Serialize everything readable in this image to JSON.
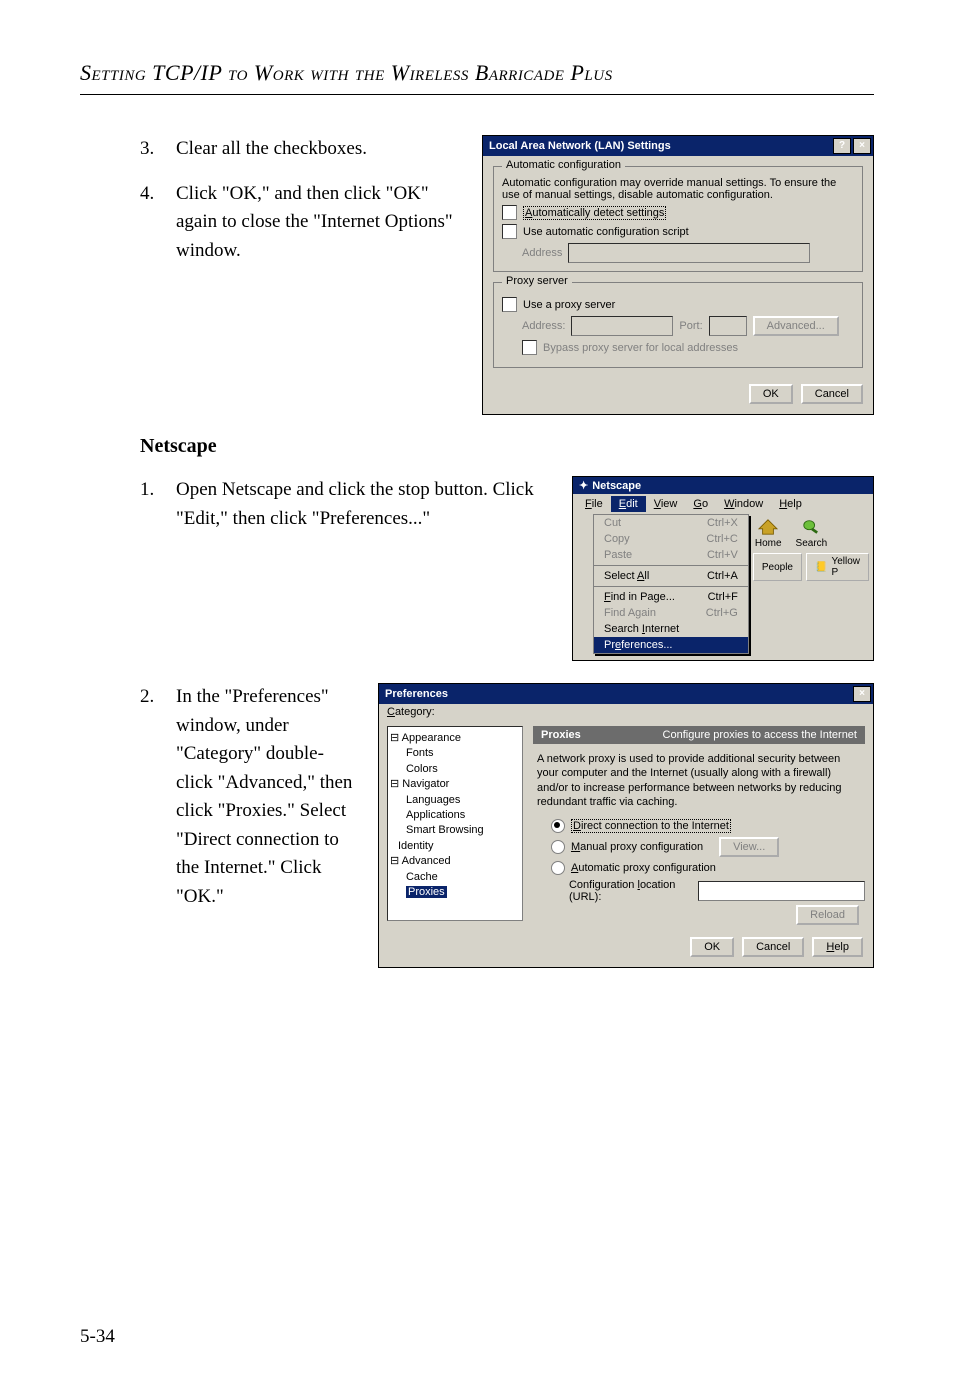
{
  "page": {
    "title": "Setting TCP/IP to Work with the Wireless Barricade Plus",
    "number": "5-34"
  },
  "sections": {
    "netscape_heading": "Netscape"
  },
  "steps_top": [
    {
      "num": "3.",
      "text": "Clear all the checkboxes."
    },
    {
      "num": "4.",
      "text": "Click \"OK,\" and then click \"OK\" again to close the \"Internet Options\" window."
    }
  ],
  "steps_netscape": [
    {
      "num": "1.",
      "text": "Open Netscape and click the stop button. Click \"Edit,\" then click \"Preferences...\""
    },
    {
      "num": "2.",
      "text": "In the \"Preferences\" window, under \"Category\" double-click \"Advanced,\" then click \"Proxies.\" Select \"Direct connection to the Internet.\" Click \"OK.\""
    }
  ],
  "lan": {
    "title": "Local Area Network (LAN) Settings",
    "group1": {
      "legend": "Automatic configuration",
      "desc": "Automatic configuration may override manual settings.  To ensure the use of manual settings, disable automatic configuration.",
      "chk_auto_detect": "Automatically detect settings",
      "chk_use_script": "Use automatic configuration script",
      "addr_label": "Address"
    },
    "group2": {
      "legend": "Proxy server",
      "chk_use_proxy": "Use a proxy server",
      "addr_label": "Address:",
      "port_label": "Port:",
      "advanced": "Advanced...",
      "chk_bypass": "Bypass proxy server for local addresses"
    },
    "ok": "OK",
    "cancel": "Cancel"
  },
  "ns": {
    "title": "Netscape",
    "menu": [
      "File",
      "Edit",
      "View",
      "Go",
      "Window",
      "Help"
    ],
    "dropdown": [
      {
        "label": "Cut",
        "accel": "Ctrl+X",
        "disabled": true
      },
      {
        "label": "Copy",
        "accel": "Ctrl+C",
        "disabled": true
      },
      {
        "label": "Paste",
        "accel": "Ctrl+V",
        "disabled": true
      },
      {
        "sep": true
      },
      {
        "label": "Select All",
        "accel": "Ctrl+A"
      },
      {
        "sep": true
      },
      {
        "label": "Find in Page...",
        "accel": "Ctrl+F"
      },
      {
        "label": "Find Again",
        "accel": "Ctrl+G",
        "disabled": true
      },
      {
        "label": "Search Internet",
        "accel": ""
      },
      {
        "label": "Preferences...",
        "accel": "",
        "selected": true
      }
    ],
    "toolbar": [
      {
        "label": "Home"
      },
      {
        "label": "Search"
      }
    ],
    "tab_people": "People",
    "tab_yellow": "Yellow P"
  },
  "pref": {
    "title": "Preferences",
    "category_label": "Category:",
    "tree": {
      "appearance": "Appearance",
      "fonts": "Fonts",
      "colors": "Colors",
      "navigator": "Navigator",
      "languages": "Languages",
      "applications": "Applications",
      "smart_browsing": "Smart Browsing",
      "identity": "Identity",
      "advanced": "Advanced",
      "cache": "Cache",
      "proxies": "Proxies"
    },
    "header_title": "Proxies",
    "header_sub": "Configure proxies to access the Internet",
    "desc": "A network proxy is used to provide additional security between your computer and the Internet (usually along with a firewall) and/or to increase performance between networks by reducing redundant traffic via caching.",
    "radio_direct": "Direct connection to the Internet",
    "radio_manual": "Manual proxy configuration",
    "view_btn": "View...",
    "radio_auto": "Automatic proxy configuration",
    "config_url": "Configuration location (URL):",
    "reload": "Reload",
    "ok": "OK",
    "cancel": "Cancel",
    "help": "Help"
  }
}
